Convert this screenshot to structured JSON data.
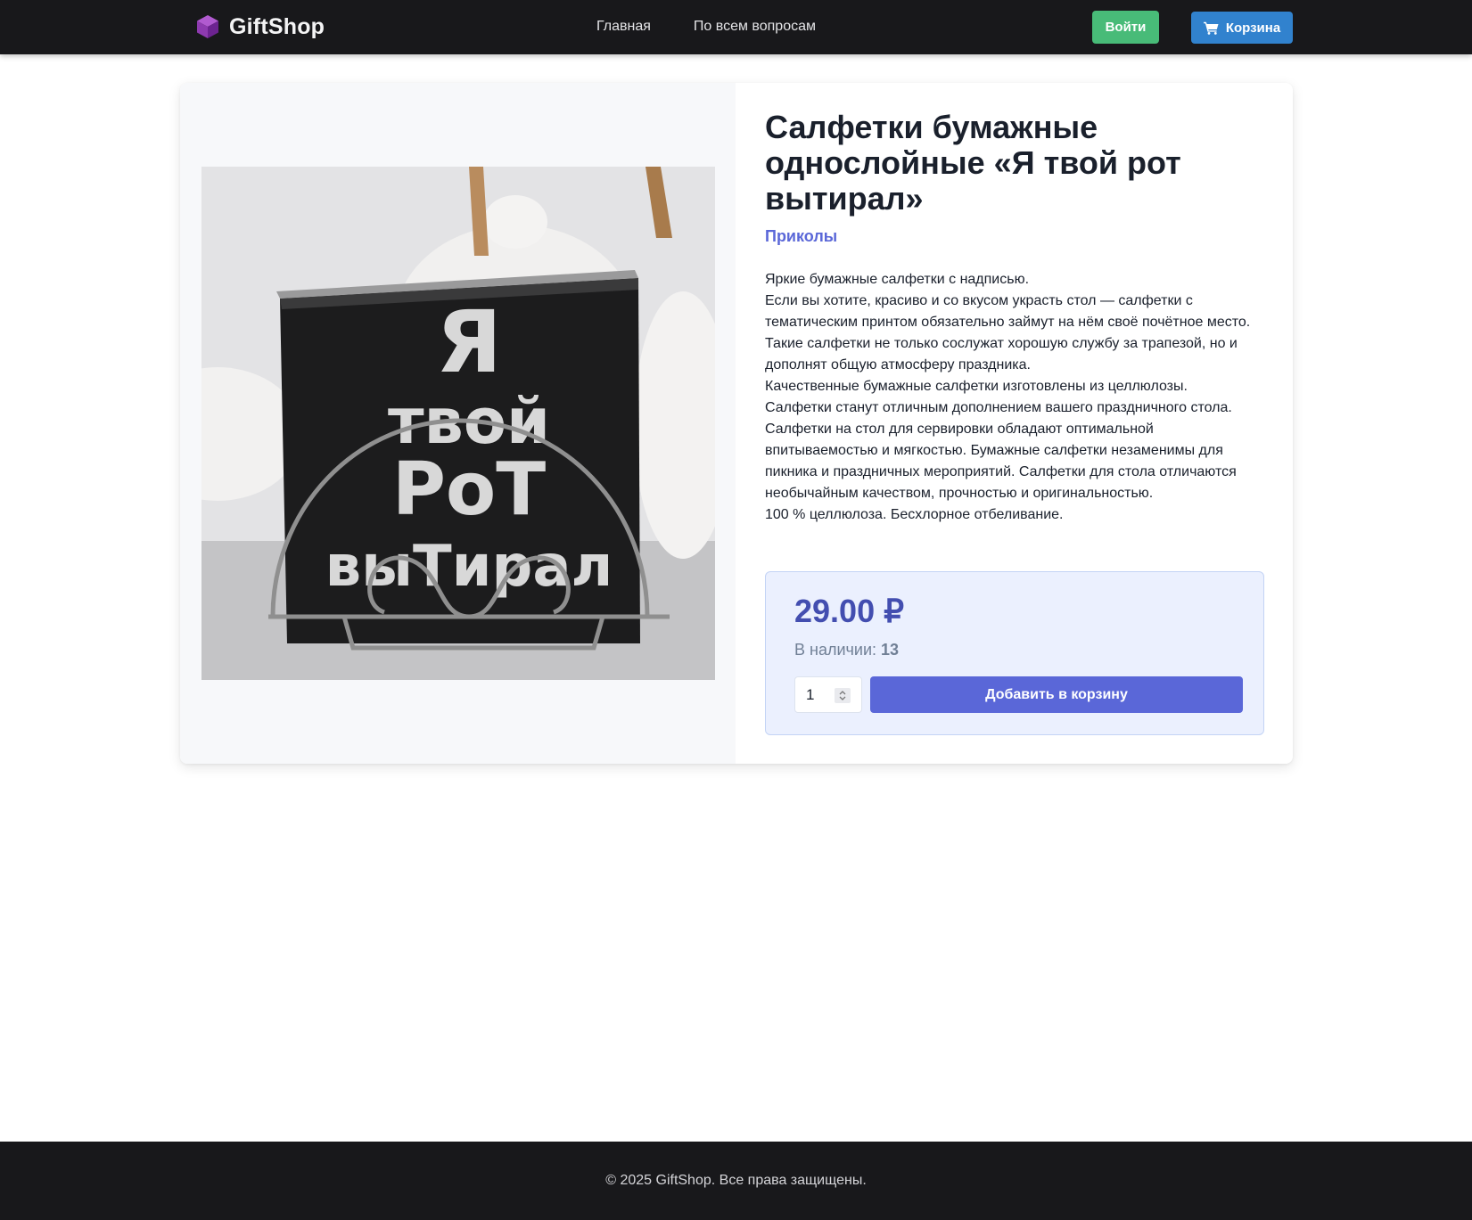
{
  "header": {
    "brand": "GiftShop",
    "nav": [
      "Главная",
      "По всем вопросам"
    ],
    "login_label": "Войти",
    "cart_label": "Корзина"
  },
  "product": {
    "title": "Салфетки бумажные однослойные «Я твой рот вытирал»",
    "category": "Приколы",
    "description": [
      "Яркие бумажные салфетки с надписью.",
      "Если вы хотите, красиво и со вкусом украсть стол — салфетки с тематическим принтом обязательно займут на нём своё почётное место.",
      "Такие салфетки не только сослужат хорошую службу за трапезой, но и дополнят общую атмосферу праздника.",
      "Качественные бумажные салфетки изготовлены из целлюлозы.",
      "Салфетки станут отличным дополнением вашего праздничного стола.",
      "Салфетки на стол для сервировки обладают оптимальной впитываемостью и мягкостью. Бумажные салфетки незаменимы для пикника и праздничных мероприятий. Салфетки для стола отличаются необычайным качеством, прочностью и оригинальностью.",
      "100 % целлюлоза. Бесхлорное отбеливание."
    ],
    "image_text": [
      "Я",
      "твой",
      "РоТ",
      "выТирал"
    ],
    "price": "29.00 ₽",
    "stock_label": "В наличии:",
    "stock_count": "13",
    "quantity": "1",
    "add_to_cart_label": "Добавить в корзину"
  },
  "footer": {
    "copyright": "© 2025 GiftShop. Все права защищены."
  },
  "colors": {
    "header_bg": "#18181b",
    "login_green": "#48bb78",
    "cart_blue": "#3182ce",
    "accent_indigo": "#5a67d8",
    "price_indigo": "#434eb0",
    "buybox_bg": "#ebf0fe"
  },
  "icons": {
    "logo": "cube-icon",
    "cart": "shopping-cart-icon"
  }
}
